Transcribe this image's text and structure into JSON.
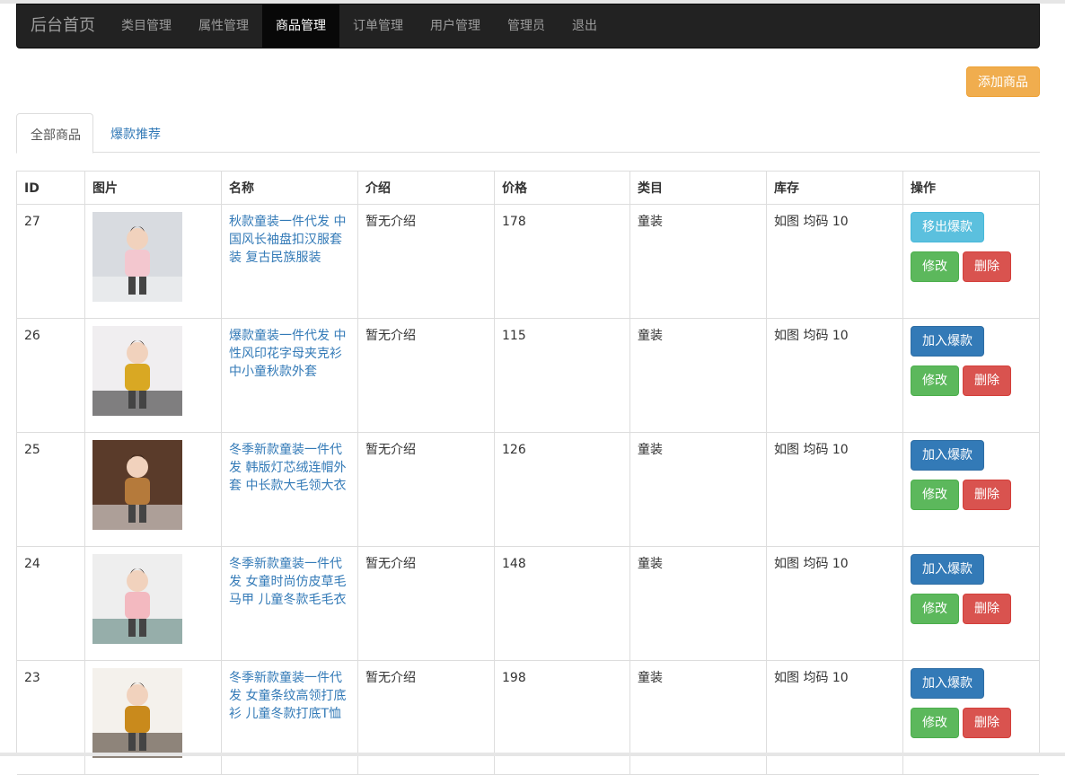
{
  "navbar": {
    "brand": "后台首页",
    "items": [
      {
        "label": "类目管理",
        "active": false
      },
      {
        "label": "属性管理",
        "active": false
      },
      {
        "label": "商品管理",
        "active": true
      },
      {
        "label": "订单管理",
        "active": false
      },
      {
        "label": "用户管理",
        "active": false
      },
      {
        "label": "管理员",
        "active": false
      },
      {
        "label": "退出",
        "active": false
      }
    ]
  },
  "toolbar": {
    "add_label": "添加商品"
  },
  "tabs": [
    {
      "label": "全部商品",
      "active": true
    },
    {
      "label": "爆款推荐",
      "active": false
    }
  ],
  "table": {
    "headers": [
      "ID",
      "图片",
      "名称",
      "介绍",
      "价格",
      "类目",
      "库存",
      "操作"
    ],
    "rows": [
      {
        "id": "27",
        "name": "秋款童装一件代发 中国风长袖盘扣汉服套装 复古民族服装",
        "intro": "暂无介绍",
        "price": "178",
        "category": "童装",
        "stock": "如图 均码 10",
        "hot_action": "移出爆款",
        "is_hot": true,
        "edit": "修改",
        "delete": "删除"
      },
      {
        "id": "26",
        "name": "爆款童装一件代发 中性风印花字母夹克衫 中小童秋款外套",
        "intro": "暂无介绍",
        "price": "115",
        "category": "童装",
        "stock": "如图 均码 10",
        "hot_action": "加入爆款",
        "is_hot": false,
        "edit": "修改",
        "delete": "删除"
      },
      {
        "id": "25",
        "name": "冬季新款童装一件代发 韩版灯芯绒连帽外套 中长款大毛领大衣",
        "intro": "暂无介绍",
        "price": "126",
        "category": "童装",
        "stock": "如图 均码 10",
        "hot_action": "加入爆款",
        "is_hot": false,
        "edit": "修改",
        "delete": "删除"
      },
      {
        "id": "24",
        "name": "冬季新款童装一件代发 女童时尚仿皮草毛马甲 儿童冬款毛毛衣",
        "intro": "暂无介绍",
        "price": "148",
        "category": "童装",
        "stock": "如图 均码 10",
        "hot_action": "加入爆款",
        "is_hot": false,
        "edit": "修改",
        "delete": "删除"
      },
      {
        "id": "23",
        "name": "冬季新款童装一件代发 女童条纹高领打底衫 儿童冬款打底T恤",
        "intro": "暂无介绍",
        "price": "198",
        "category": "童装",
        "stock": "如图 均码 10",
        "hot_action": "加入爆款",
        "is_hot": false,
        "edit": "修改",
        "delete": "删除"
      }
    ]
  },
  "colors": {
    "navbar_bg": "#222222",
    "link": "#337ab7",
    "warning": "#f0ad4e",
    "info": "#5bc0de",
    "primary": "#337ab7",
    "success": "#5cb85c",
    "danger": "#d9534f"
  }
}
